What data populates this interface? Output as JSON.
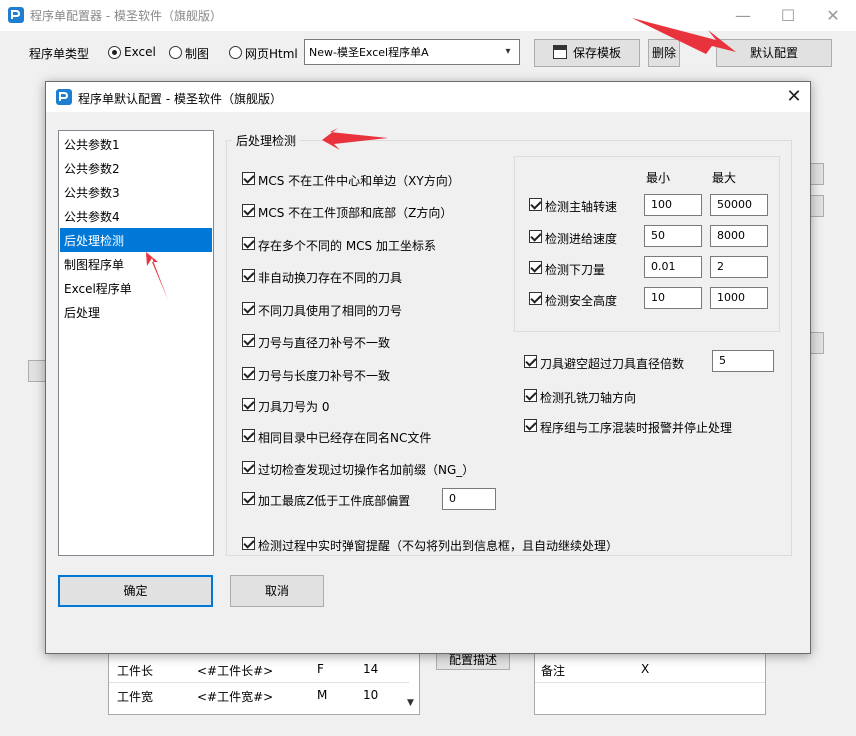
{
  "main_window": {
    "title": "程序单配置器 - 模圣软件（旗舰版）",
    "minimize": "—",
    "maximize": "☐",
    "close": "✕",
    "type_label": "程序单类型",
    "radios": [
      {
        "label": "Excel",
        "checked": true
      },
      {
        "label": "制图",
        "checked": false
      },
      {
        "label": "网页Html",
        "checked": false
      }
    ],
    "template_select": "New-模圣Excel程序单A",
    "save_template": "保存模板",
    "delete": "删除",
    "default_config": "默认配置",
    "config_describe": "配置描述",
    "bottom_table_left": [
      {
        "name": "工件长",
        "tag": "<#工件长#>",
        "code": "F",
        "num": "14"
      },
      {
        "name": "工件宽",
        "tag": "<#工件宽#>",
        "code": "M",
        "num": "10"
      }
    ],
    "bottom_table_right": [
      {
        "name": "备注",
        "value": "X"
      }
    ]
  },
  "dialog": {
    "title": "程序单默认配置 - 模圣软件（旗舰版）",
    "close": "✕",
    "nav_items": [
      "公共参数1",
      "公共参数2",
      "公共参数3",
      "公共参数4",
      "后处理检测",
      "制图程序单",
      "Excel程序单",
      "后处理"
    ],
    "selected_nav": "后处理检测",
    "group_title": "后处理检测",
    "checks": [
      {
        "label": "MCS 不在工件中心和单边（XY方向）",
        "checked": true
      },
      {
        "label": "MCS 不在工件顶部和底部（Z方向）",
        "checked": true
      },
      {
        "label": "存在多个不同的 MCS 加工坐标系",
        "checked": true
      },
      {
        "label": "非自动换刀存在不同的刀具",
        "checked": true
      },
      {
        "label": "不同刀具使用了相同的刀号",
        "checked": true
      },
      {
        "label": "刀号与直径刀补号不一致",
        "checked": true
      },
      {
        "label": "刀号与长度刀补号不一致",
        "checked": true
      },
      {
        "label": "刀具刀号为 0",
        "checked": true
      },
      {
        "label": "相同目录中已经存在同名NC文件",
        "checked": true
      },
      {
        "label": "过切检查发现过切操作名加前缀（NG_）",
        "checked": true
      },
      {
        "label": "加工最底Z低于工件底部偏置",
        "checked": true,
        "value": "0"
      }
    ],
    "realtime_check": {
      "label": "检测过程中实时弹窗提醒（不勾将列出到信息框，且自动继续处理）",
      "checked": true
    },
    "range_header_min": "最小",
    "range_header_max": "最大",
    "range_checks": [
      {
        "label": "检测主轴转速",
        "checked": true,
        "min": "100",
        "max": "50000"
      },
      {
        "label": "检测进给速度",
        "checked": true,
        "min": "50",
        "max": "8000"
      },
      {
        "label": "检测下刀量",
        "checked": true,
        "min": "0.01",
        "max": "2"
      },
      {
        "label": "检测安全高度",
        "checked": true,
        "min": "10",
        "max": "1000"
      }
    ],
    "right_checks": [
      {
        "label": "刀具避空超过刀具直径倍数",
        "checked": true,
        "value": "5"
      },
      {
        "label": "检测孔铣刀轴方向",
        "checked": true
      },
      {
        "label": "程序组与工序混装时报警并停止处理",
        "checked": true
      }
    ],
    "ok": "确定",
    "cancel": "取消"
  },
  "colors": {
    "selection": "#0078d7",
    "annotation_arrow": "#e8323c"
  }
}
